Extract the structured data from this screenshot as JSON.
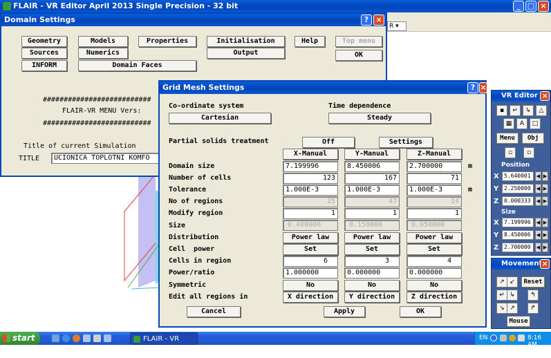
{
  "main_title": "FLAIR - VR Editor April 2013 Single Precision - 32 bit",
  "bg_dropdown_text": "R",
  "domain_settings": {
    "title": "Domain Settings",
    "buttons": {
      "geometry": "Geometry",
      "models": "Models",
      "properties": "Properties",
      "initialisation": "Initialisation",
      "help": "Help",
      "top_menu": "Top menu",
      "sources": "Sources",
      "numerics": "Numerics",
      "output": "Output",
      "ok": "OK",
      "inform": "INFORM",
      "domain_faces": "Domain Faces"
    },
    "hash_line": "##########################",
    "menu_text": "FLAIR-VR MENU   Vers:",
    "sim_title_label": "Title of current Simulation",
    "title_label": "TITLE",
    "title_value": "UCIONICA TOPLOTNI KOMFO"
  },
  "grid_mesh": {
    "title": "Grid Mesh Settings",
    "coord_label": "Co-ordinate system",
    "coord_value": "Cartesian",
    "time_label": "Time dependence",
    "time_value": "Steady",
    "partial_label": "Partial solids treatment",
    "partial_value": "Off",
    "settings_btn": "Settings",
    "headers": [
      "X-Manual",
      "Y-Manual",
      "Z-Manual"
    ],
    "rows": {
      "domain_size": {
        "label": "Domain size",
        "values": [
          "7.199996",
          "8.450006",
          "2.700000"
        ],
        "unit": "m"
      },
      "cells": {
        "label": "Number of cells",
        "values": [
          "123",
          "167",
          "71"
        ]
      },
      "tolerance": {
        "label": "Tolerance",
        "values": [
          "1.000E-3",
          "1.000E-3",
          "1.000E-3"
        ],
        "unit": "m"
      },
      "regions": {
        "label": "No of regions",
        "values": [
          "25",
          "47",
          "14"
        ]
      },
      "modify": {
        "label": "Modify region",
        "values": [
          "1",
          "1",
          "1"
        ]
      },
      "size": {
        "label": "Size",
        "values": [
          "0.400000",
          "0.150000",
          "0.050000"
        ]
      },
      "distribution": {
        "label": "Distribution",
        "values": [
          "Power law",
          "Power law",
          "Power law"
        ]
      },
      "cellpower": {
        "label": "Cell  power",
        "values": [
          "Set",
          "Set",
          "Set"
        ]
      },
      "cellsreg": {
        "label": "Cells in region",
        "values": [
          "6",
          "3",
          "4"
        ]
      },
      "power": {
        "label": "Power/ratio",
        "values": [
          "1.000000",
          "0.000000",
          "0.000000"
        ]
      },
      "symmetric": {
        "label": "Symmetric",
        "values": [
          "No",
          "No",
          "No"
        ]
      },
      "edit": {
        "label": "Edit all regions in",
        "values": [
          "X direction",
          "Y direction",
          "Z direction"
        ]
      }
    },
    "cancel": "Cancel",
    "apply": "Apply",
    "ok": "OK"
  },
  "vr_editor": {
    "title": "VR Editor",
    "menu": "Menu",
    "obj": "Obj",
    "position_label": "Position",
    "pos": {
      "x": "5.640001",
      "y": "2.250000",
      "z": "0.000333"
    },
    "size_label": "Size",
    "size": {
      "x": "7.199996",
      "y": "8.450006",
      "z": "2.700000"
    }
  },
  "movement": {
    "title": "Movement",
    "reset": "Reset",
    "mouse": "Mouse"
  },
  "taskbar": {
    "start": "start",
    "task": "FLAIR - VR Editor Apr...",
    "lang": "EN",
    "clock": "8:16 AM"
  },
  "colors": {
    "xp_blue": "#0046b8",
    "flair_panel": "#ece9d8",
    "vr_panel": "#3f5f9a",
    "taskbar": "#245edb",
    "start_green": "#3c9a3c"
  }
}
